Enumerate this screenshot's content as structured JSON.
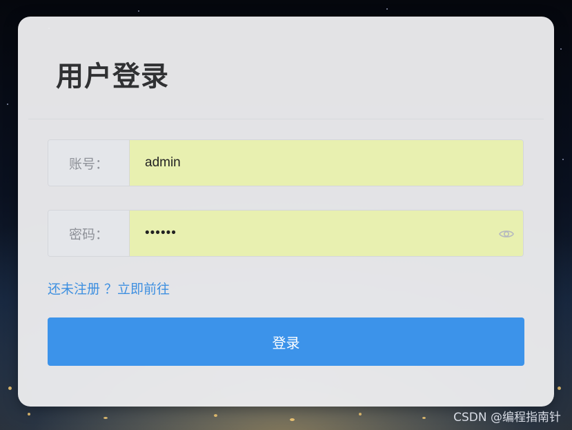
{
  "login": {
    "title": "用户登录",
    "username_label": "账号：",
    "username_value": "admin",
    "password_label": "密码：",
    "password_value": "••••••",
    "register_link": "还未注册 ？立即前往",
    "login_button": "登录"
  },
  "watermark": "CSDN @编程指南针",
  "icons": {
    "password_toggle": "eye-icon"
  },
  "colors": {
    "accent": "#3c93ea",
    "link": "#3d8fe0",
    "autofill": "#e8f0b0",
    "card": "#ececee"
  }
}
